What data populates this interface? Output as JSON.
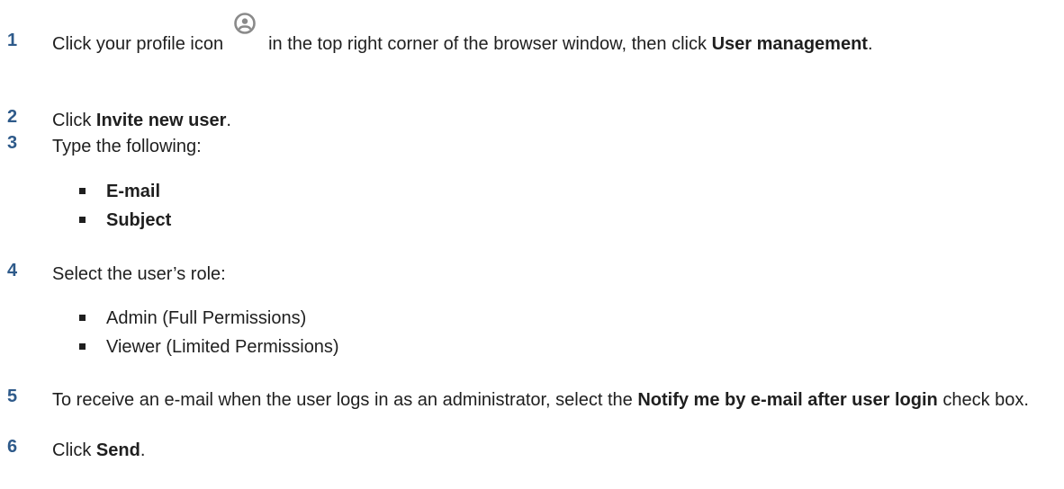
{
  "steps": [
    {
      "number": "1",
      "before_icon": "Click your profile icon",
      "icon": "profile-icon",
      "after_icon": "in the top right corner of the browser window, then click",
      "bold": "User management",
      "end": "."
    },
    {
      "number": "2",
      "text": "Click",
      "bold": "Invite new user",
      "end": "."
    },
    {
      "number": "3",
      "text": "Type the following:",
      "bullets": [
        "E-mail",
        "Subject"
      ]
    },
    {
      "number": "4",
      "text": "Select the user’s role:",
      "bullets": [
        "Admin (Full Permissions)",
        "Viewer (Limited Permissions)"
      ]
    },
    {
      "number": "5",
      "text": "To receive an e-mail when the user logs in as an administrator, select the",
      "bold": "Notify me by e-mail after user login",
      "end": "check box."
    },
    {
      "number": "6",
      "text": "Click",
      "bold": "Send",
      "end": "."
    }
  ],
  "colors": {
    "step_number": "#2e5a8a",
    "icon": "#8a8a8a"
  }
}
